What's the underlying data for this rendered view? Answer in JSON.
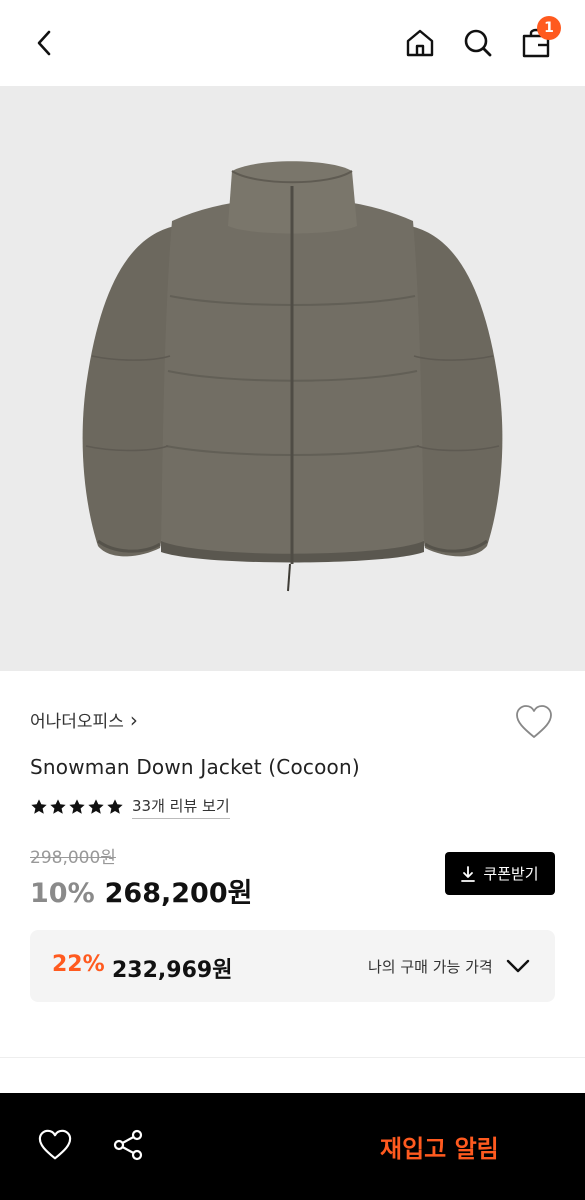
{
  "header": {
    "cart_count": "1"
  },
  "product": {
    "brand": "어나더오피스",
    "brand_chevron": "›",
    "title": "Snowman Down Jacket (Cocoon)",
    "rating_stars": 5,
    "review_link": "33개 리뷰 보기",
    "original_price": "298,000원",
    "discount_rate": "10%",
    "sale_price": "268,200원",
    "coupon_label": "쿠폰받기"
  },
  "my_price": {
    "discount_rate": "22%",
    "price": "232,969원",
    "label": "나의 구매 가능 가격"
  },
  "bottom_bar": {
    "restock_label": "재입고 알림"
  },
  "colors": {
    "accent": "#ff5a1f",
    "jacket": "#6f6b61",
    "background_image": "#ebebeb"
  }
}
